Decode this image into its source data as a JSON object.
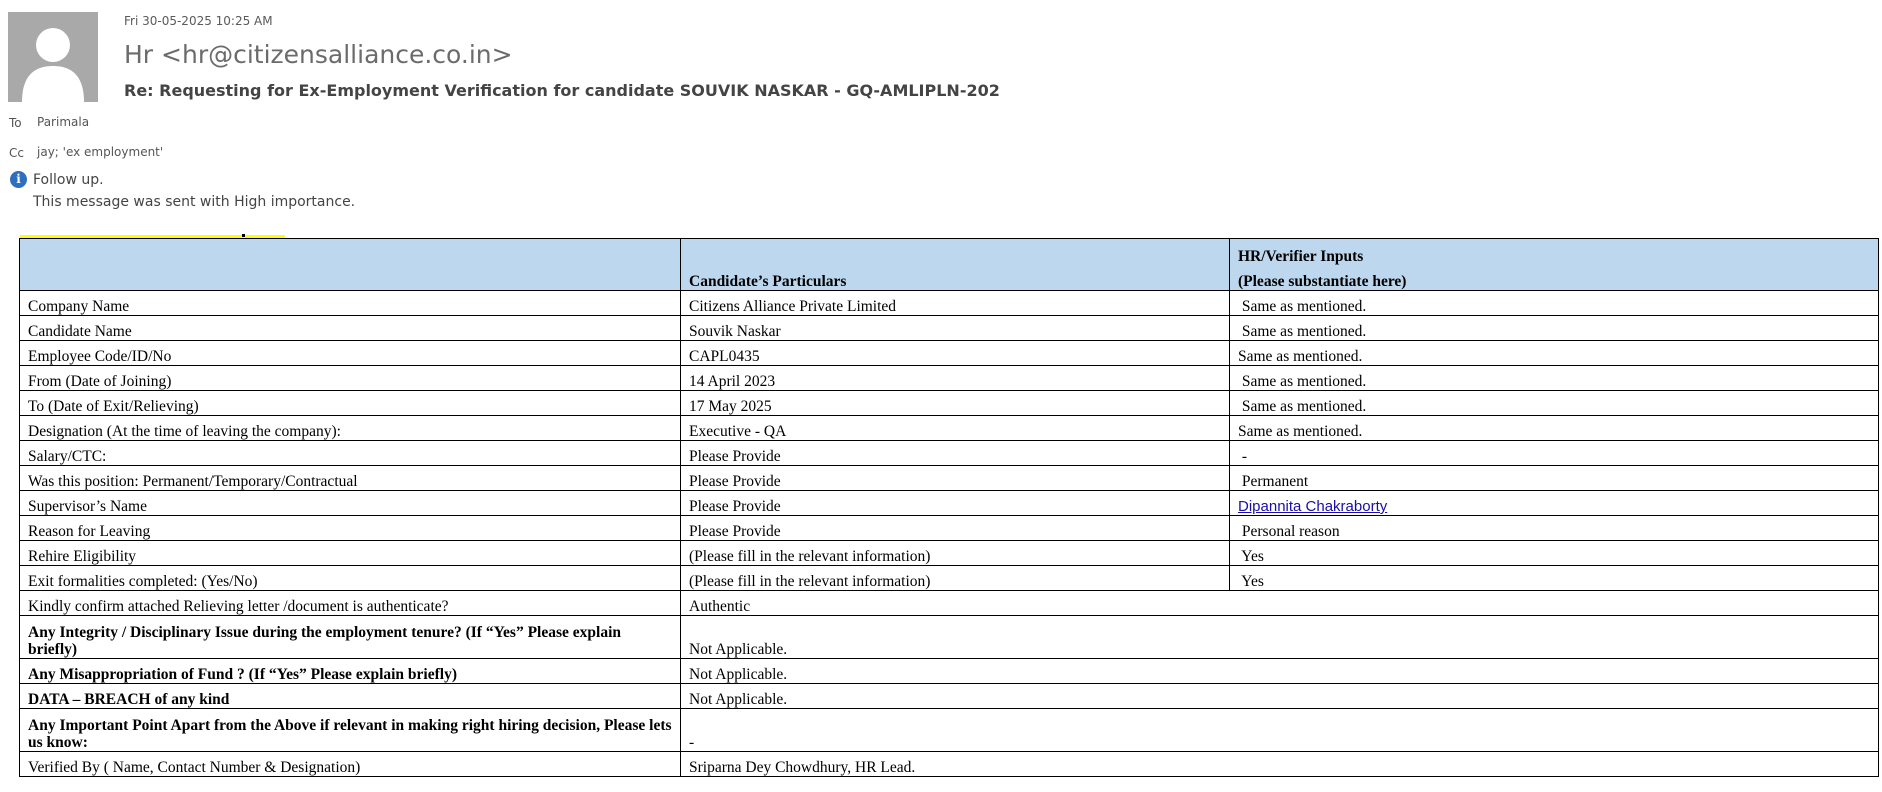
{
  "email": {
    "date": "Fri 30-05-2025 10:25 AM",
    "sender": "Hr <hr@citizensalliance.co.in>",
    "subject": "Re: Requesting for Ex-Employment Verification for candidate SOUVIK NASKAR - GQ-AMLIPLN-202",
    "to_label": "To",
    "to_value": "Parimala",
    "cc_label": "Cc",
    "cc_value": "jay; 'ex employment'",
    "followup": "Follow up.",
    "importance": "This message was sent with High importance."
  },
  "table": {
    "header": {
      "col1": "",
      "col2": "Candidate’s Particulars",
      "col3_line1": "HR/Verifier Inputs",
      "col3_line2": "(Please substantiate here)"
    },
    "rows": [
      {
        "label": "Company Name",
        "particulars": "Citizens Alliance Private Limited",
        "input": " Same as mentioned."
      },
      {
        "label": "Candidate Name",
        "particulars": "Souvik Naskar",
        "input": " Same as mentioned."
      },
      {
        "label": "Employee Code/ID/No",
        "particulars": "CAPL0435",
        "input": "Same as mentioned."
      },
      {
        "label": "From (Date of Joining)",
        "particulars": "14 April 2023",
        "input": " Same as mentioned."
      },
      {
        "label": "To (Date of Exit/Relieving)",
        "particulars": "17 May 2025",
        "input": " Same as mentioned."
      },
      {
        "label": "Designation (At the time of leaving the company):",
        "particulars": "Executive - QA",
        "input": "Same as mentioned."
      },
      {
        "label": "Salary/CTC:",
        "particulars": "Please Provide",
        "input": " -"
      },
      {
        "label": "Was this position: Permanent/Temporary/Contractual",
        "particulars": "Please Provide",
        "input": " Permanent"
      },
      {
        "label": "Supervisor’s Name",
        "particulars": "Please Provide",
        "input": "Dipannita Chakraborty"
      },
      {
        "label": "Reason for Leaving",
        "particulars": "Please Provide",
        "input": " Personal reason"
      },
      {
        "label": "Rehire Eligibility",
        "particulars": "(Please fill in the relevant information)",
        "input": " Yes"
      },
      {
        "label": "Exit formalities completed: (Yes/No)",
        "particulars": "(Please fill in the relevant information)",
        "input": " Yes"
      }
    ],
    "wide_rows": [
      {
        "label": "Kindly confirm attached Relieving letter /document is authenticate?",
        "value": "Authentic"
      },
      {
        "label": "Any Integrity / Disciplinary Issue during the employment tenure? (If “Yes” Please explain briefly)",
        "value": "Not Applicable."
      },
      {
        "label": "Any Misappropriation of Fund ? (If “Yes” Please explain briefly)",
        "value": "Not Applicable."
      },
      {
        "label": "DATA – BREACH of any kind",
        "value": "Not Applicable."
      },
      {
        "label": "Any Important Point Apart from the Above if relevant in making right hiring decision, Please lets us know:",
        "value": "-"
      },
      {
        "label": "Verified By ( Name, Contact Number & Designation)",
        "value": "Sriparna Dey Chowdhury, HR Lead."
      }
    ]
  },
  "colors": {
    "header_bg": "#bdd7ee",
    "link": "#1a0dab",
    "info_icon": "#2d6ebf",
    "highlight": "#ffff00"
  },
  "icons": {
    "avatar": "person-silhouette-icon",
    "info": "info-icon"
  }
}
